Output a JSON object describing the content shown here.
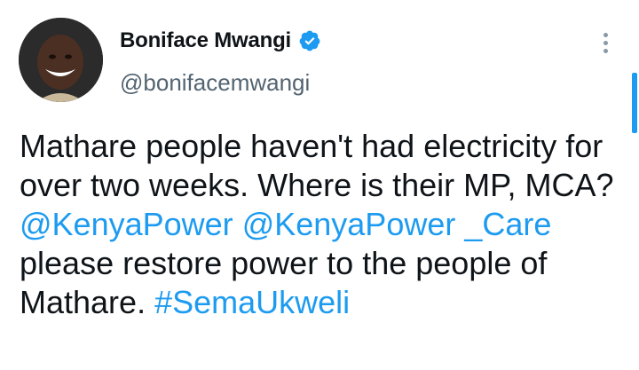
{
  "author": {
    "display_name": "Boniface Mwangi",
    "handle": "@bonifacemwangi",
    "verified": true,
    "avatar_icon": "user-avatar-photo"
  },
  "tweet": {
    "text_part1": "Mathare people haven't had electricity for over two weeks. Where is their MP, MCA? ",
    "mention1": "@KenyaPower",
    "text_part2": " ",
    "mention2": "@KenyaPower _Care",
    "text_part3": " please restore power to the people of Mathare. ",
    "hashtag": "#SemaUkweli"
  },
  "colors": {
    "link": "#1d9bf0",
    "text": "#0f1419",
    "muted": "#536471"
  }
}
